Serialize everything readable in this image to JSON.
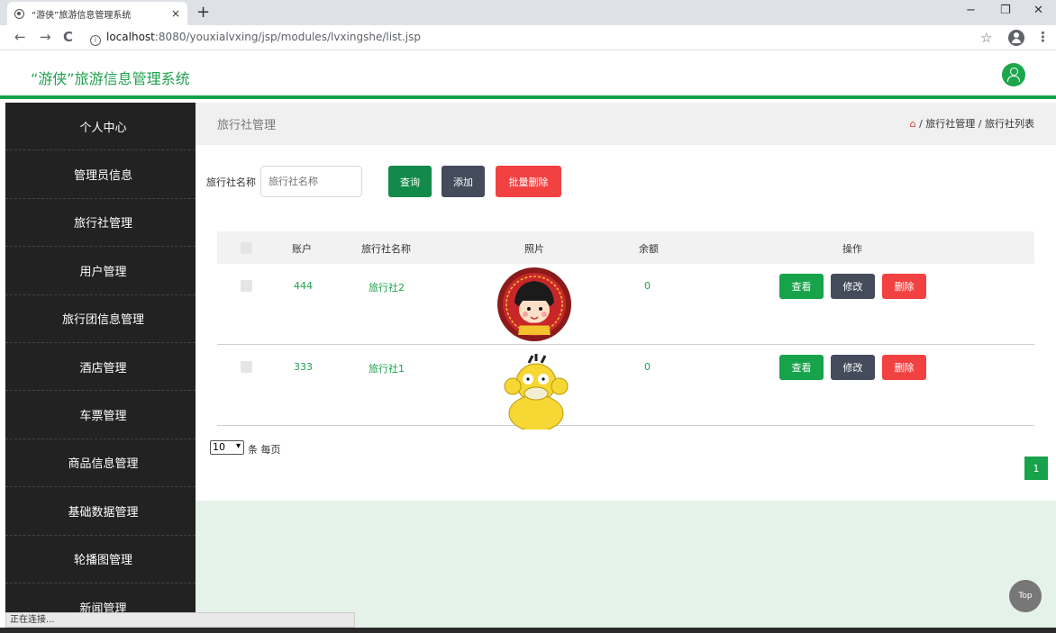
{
  "browser": {
    "tab_title": "“游侠”旅游信息管理系统",
    "tab_close": "×",
    "new_tab": "+",
    "window_controls": {
      "minimize": "−",
      "restore": "❐",
      "close": "✕"
    },
    "nav": {
      "back": "←",
      "forward": "→",
      "reload": "C"
    },
    "url_host": "localhost",
    "url_path": ":8080/youxialvxing/jsp/modules/lvxingshe/list.jsp",
    "star": "☆",
    "menu": "⋮"
  },
  "header": {
    "title": "“游侠”旅游信息管理系统"
  },
  "sidebar": {
    "items": [
      {
        "label": "个人中心"
      },
      {
        "label": "管理员信息"
      },
      {
        "label": "旅行社管理"
      },
      {
        "label": "用户管理"
      },
      {
        "label": "旅行团信息管理"
      },
      {
        "label": "酒店管理"
      },
      {
        "label": "车票管理"
      },
      {
        "label": "商品信息管理"
      },
      {
        "label": "基础数据管理"
      },
      {
        "label": "轮播图管理"
      },
      {
        "label": "新闻管理"
      }
    ]
  },
  "breadcrumb": {
    "title": "旅行社管理",
    "home_icon": "⌂",
    "sep": "/",
    "level1": "旅行社管理",
    "level2": "旅行社列表"
  },
  "search": {
    "label": "旅行社名称",
    "placeholder": "旅行社名称",
    "query_label": "查询",
    "add_label": "添加",
    "batch_delete_label": "批量删除"
  },
  "table": {
    "headers": {
      "account": "账户",
      "name": "旅行社名称",
      "photo": "照片",
      "balance": "余额",
      "actions": "操作"
    },
    "rows": [
      {
        "account": "444",
        "name": "旅行社2",
        "balance": "0"
      },
      {
        "account": "333",
        "name": "旅行社1",
        "balance": "0"
      }
    ],
    "view_label": "查看",
    "edit_label": "修改",
    "delete_label": "删除"
  },
  "pager": {
    "page_size": "10",
    "per_page_text": "条 每页",
    "current_page": "1"
  },
  "top_button": "Top",
  "status_text": "正在连接..."
}
